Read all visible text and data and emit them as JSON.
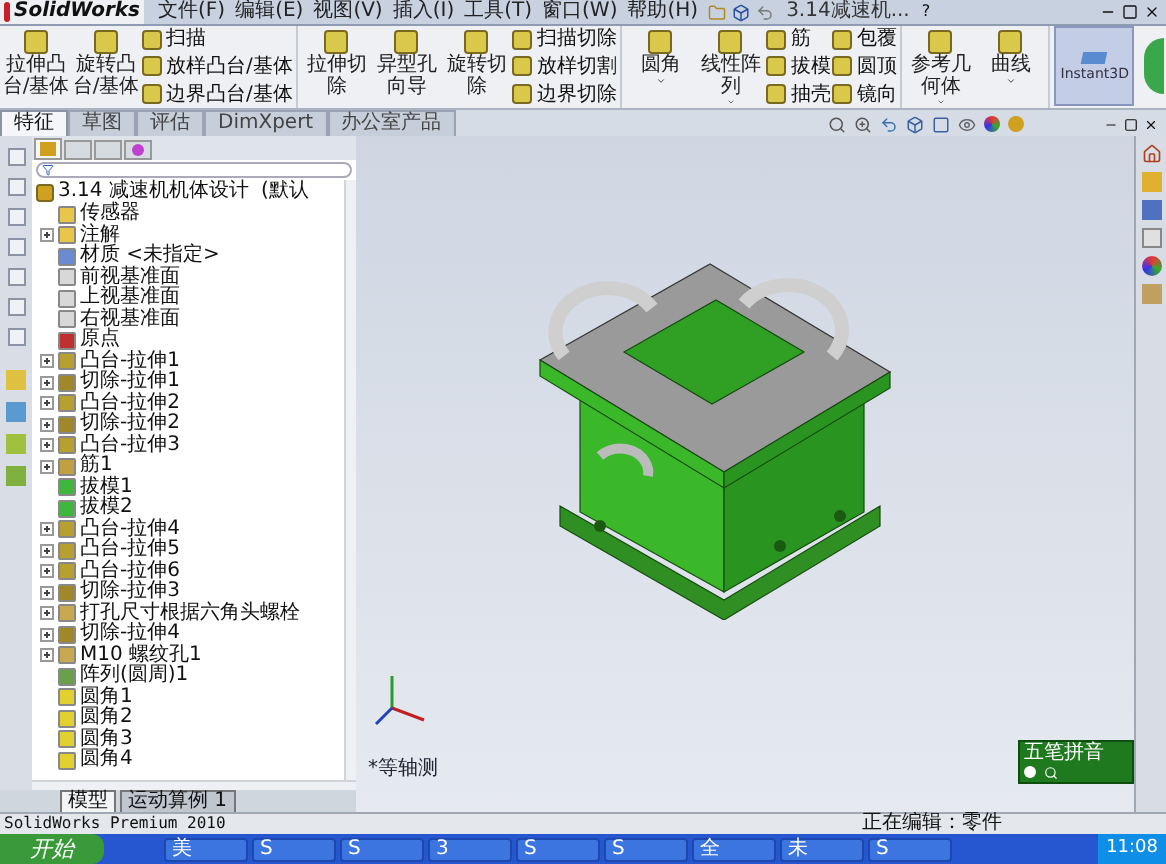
{
  "app": {
    "logo": "SolidWorks",
    "menus": [
      "文件(F)",
      "编辑(E)",
      "视图(V)",
      "插入(I)",
      "工具(T)",
      "窗口(W)",
      "帮助(H)"
    ],
    "document_title": "3.14减速机...",
    "help": "?"
  },
  "ribbon": {
    "groups": [
      {
        "large": [
          {
            "label": "拉伸凸台/基体",
            "dropdown": false
          },
          {
            "label": "旋转凸台/基体",
            "dropdown": false
          }
        ],
        "small": [
          [
            "扫描",
            "放样凸台/基体",
            "边界凸台/基体"
          ]
        ]
      },
      {
        "large": [
          {
            "label": "拉伸切除",
            "dropdown": false
          },
          {
            "label": "异型孔向导",
            "dropdown": false
          },
          {
            "label": "旋转切除",
            "dropdown": false
          }
        ],
        "small": [
          [
            "扫描切除",
            "放样切割",
            "边界切除"
          ]
        ]
      },
      {
        "large": [
          {
            "label": "圆角",
            "dropdown": true
          },
          {
            "label": "线性阵列",
            "dropdown": true
          }
        ],
        "small": [
          [
            "筋",
            "拔模",
            "抽壳"
          ],
          [
            "包覆",
            "圆顶",
            "镜向"
          ]
        ]
      },
      {
        "large": [
          {
            "label": "参考几何体",
            "dropdown": true
          },
          {
            "label": "曲线",
            "dropdown": true
          }
        ]
      }
    ],
    "instant3d": {
      "label": "Instant3D",
      "on": true
    }
  },
  "command_tabs": [
    {
      "label": "特征",
      "selected": true
    },
    {
      "label": "草图",
      "selected": false
    },
    {
      "label": "评估",
      "selected": false
    },
    {
      "label": "DimXpert",
      "selected": false
    },
    {
      "label": "办公室产品",
      "selected": false
    }
  ],
  "tree": {
    "root": {
      "label": "3.14 减速机机体设计",
      "config": "(默认"
    },
    "items": [
      {
        "label": "传感器",
        "kind": "sensor",
        "collapsed": false
      },
      {
        "label": "注解",
        "kind": "annotation",
        "collapsed": true
      },
      {
        "label": "材质 <未指定>",
        "kind": "material",
        "collapsed": false
      },
      {
        "label": "前视基准面",
        "kind": "plane",
        "collapsed": false
      },
      {
        "label": "上视基准面",
        "kind": "plane",
        "collapsed": false
      },
      {
        "label": "右视基准面",
        "kind": "plane",
        "collapsed": false
      },
      {
        "label": "原点",
        "kind": "origin",
        "collapsed": false
      },
      {
        "label": "凸台-拉伸1",
        "kind": "boss",
        "collapsed": true
      },
      {
        "label": "切除-拉伸1",
        "kind": "cut",
        "collapsed": true
      },
      {
        "label": "凸台-拉伸2",
        "kind": "boss",
        "collapsed": true
      },
      {
        "label": "切除-拉伸2",
        "kind": "cut",
        "collapsed": true
      },
      {
        "label": "凸台-拉伸3",
        "kind": "boss",
        "collapsed": true
      },
      {
        "label": "筋1",
        "kind": "rib",
        "collapsed": true
      },
      {
        "label": "拔模1",
        "kind": "draft",
        "collapsed": false
      },
      {
        "label": "拔模2",
        "kind": "draft",
        "collapsed": false
      },
      {
        "label": "凸台-拉伸4",
        "kind": "boss",
        "collapsed": true
      },
      {
        "label": "凸台-拉伸5",
        "kind": "boss",
        "collapsed": true
      },
      {
        "label": "凸台-拉伸6",
        "kind": "boss",
        "collapsed": true
      },
      {
        "label": "切除-拉伸3",
        "kind": "cut",
        "collapsed": true
      },
      {
        "label": "打孔尺寸根据六角头螺栓",
        "kind": "hole",
        "collapsed": true
      },
      {
        "label": "切除-拉伸4",
        "kind": "cut",
        "collapsed": true
      },
      {
        "label": "M10 螺纹孔1",
        "kind": "hole",
        "collapsed": true
      },
      {
        "label": "阵列(圆周)1",
        "kind": "pattern",
        "collapsed": false
      },
      {
        "label": "圆角1",
        "kind": "fillet",
        "collapsed": false
      },
      {
        "label": "圆角2",
        "kind": "fillet",
        "collapsed": false
      },
      {
        "label": "圆角3",
        "kind": "fillet",
        "collapsed": false
      },
      {
        "label": "圆角4",
        "kind": "fillet",
        "collapsed": false
      }
    ]
  },
  "bottom_tabs": [
    {
      "label": "模型",
      "selected": true
    },
    {
      "label": "运动算例 1",
      "selected": false
    }
  ],
  "viewport": {
    "view_label": "*等轴测"
  },
  "ime": {
    "label": "五笔拼音"
  },
  "status_bar": {
    "product": "SolidWorks Premium 2010",
    "mode": "正在编辑：零件"
  },
  "taskbar": {
    "start": "开始",
    "items": [
      "美",
      "S",
      "S",
      "3",
      "S",
      "S",
      "全",
      "未",
      "S"
    ],
    "clock": "11:08"
  }
}
